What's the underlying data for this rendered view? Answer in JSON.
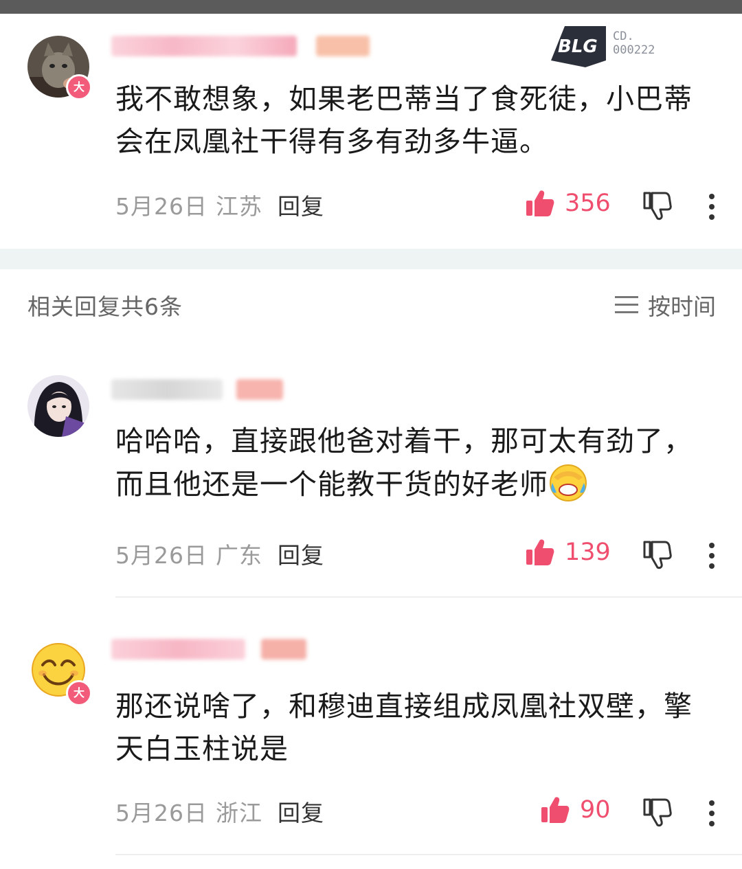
{
  "top_comment": {
    "text": "我不敢想象，如果老巴蒂当了食死徒，小巴蒂会在凤凰社干得有多有劲多牛逼。",
    "date": "5月26日",
    "location": "江苏",
    "reply_label": "回复",
    "likes": "356",
    "badge": "大"
  },
  "logo": {
    "line1": "CD.",
    "line2": "000222"
  },
  "replies_header": {
    "title": "相关回复共6条",
    "sort_label": "按时间"
  },
  "replies": [
    {
      "text": "哈哈哈，直接跟他爸对着干，那可太有劲了，而且他还是一个能教干货的好老师",
      "emoji": "laugh-cry-emoji",
      "date": "5月26日",
      "location": "广东",
      "reply_label": "回复",
      "likes": "139"
    },
    {
      "text": "那还说啥了，和穆迪直接组成凤凰社双壁，擎天白玉柱说是",
      "date": "5月26日",
      "location": "浙江",
      "reply_label": "回复",
      "likes": "90",
      "badge": "大"
    }
  ],
  "colors": {
    "accent": "#f04e6e",
    "vip": "#f25c7a",
    "band": "#eef3f4"
  }
}
